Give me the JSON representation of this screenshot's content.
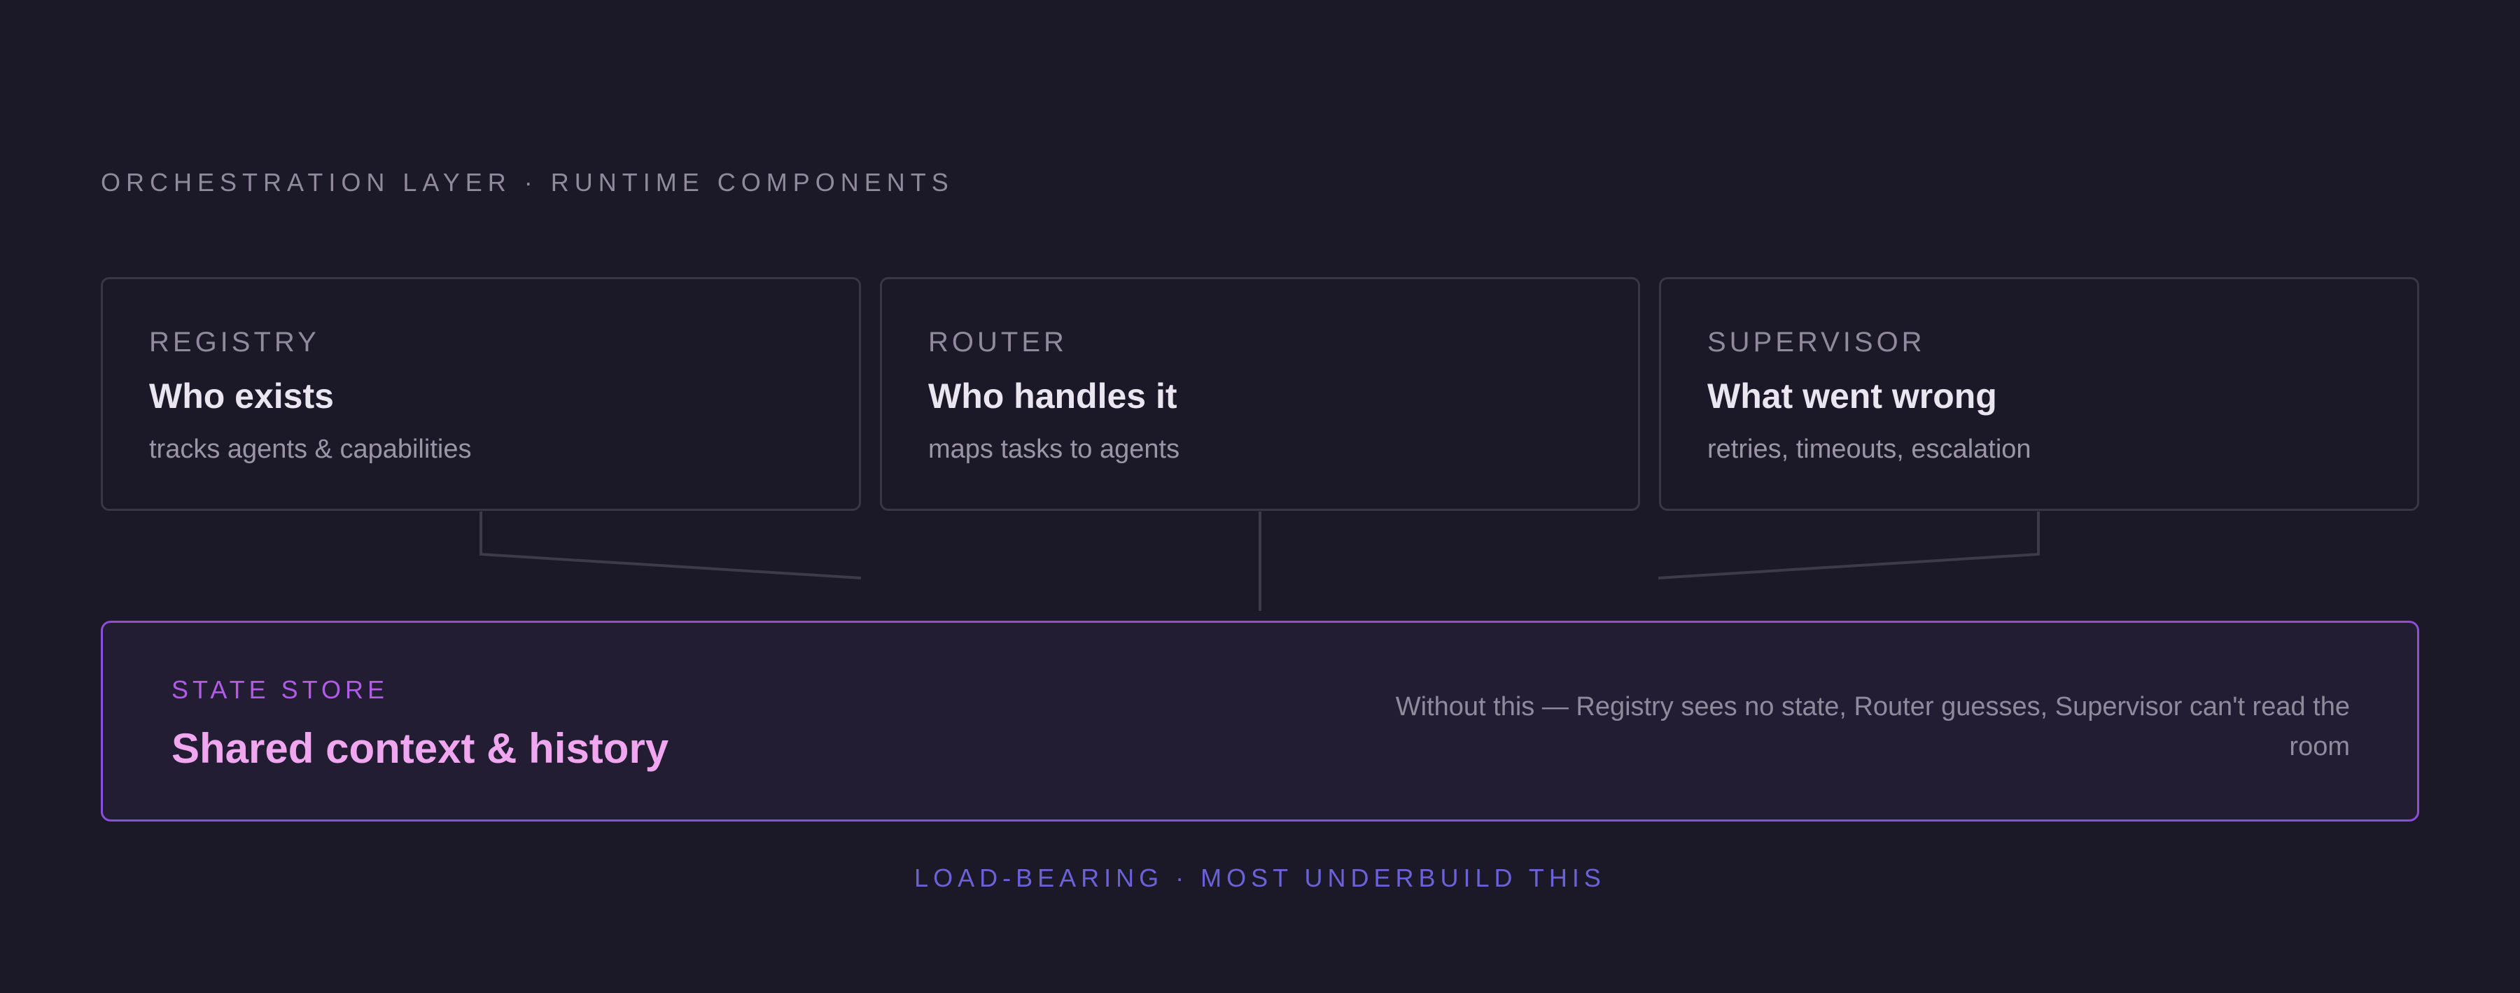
{
  "header": {
    "section_label": "ORCHESTRATION LAYER · RUNTIME COMPONENTS"
  },
  "cards": [
    {
      "eyebrow": "REGISTRY",
      "title": "Who exists",
      "subtitle": "tracks agents & capabilities"
    },
    {
      "eyebrow": "ROUTER",
      "title": "Who handles it",
      "subtitle": "maps tasks to agents"
    },
    {
      "eyebrow": "SUPERVISOR",
      "title": "What went wrong",
      "subtitle": "retries, timeouts, escalation"
    }
  ],
  "state_store": {
    "eyebrow": "STATE STORE",
    "title": "Shared context & history",
    "note": "Without this — Registry sees no state, Router guesses, Supervisor can't read the room"
  },
  "footer": {
    "label": "LOAD-BEARING · MOST UNDERBUILD THIS"
  },
  "colors": {
    "background": "#1b1827",
    "card_border": "#3a3647",
    "state_store_border": "#8d4fd6",
    "state_store_title": "#f0a7f0",
    "state_store_eyebrow": "#b15ce6",
    "footer_accent": "#6b62d9"
  }
}
